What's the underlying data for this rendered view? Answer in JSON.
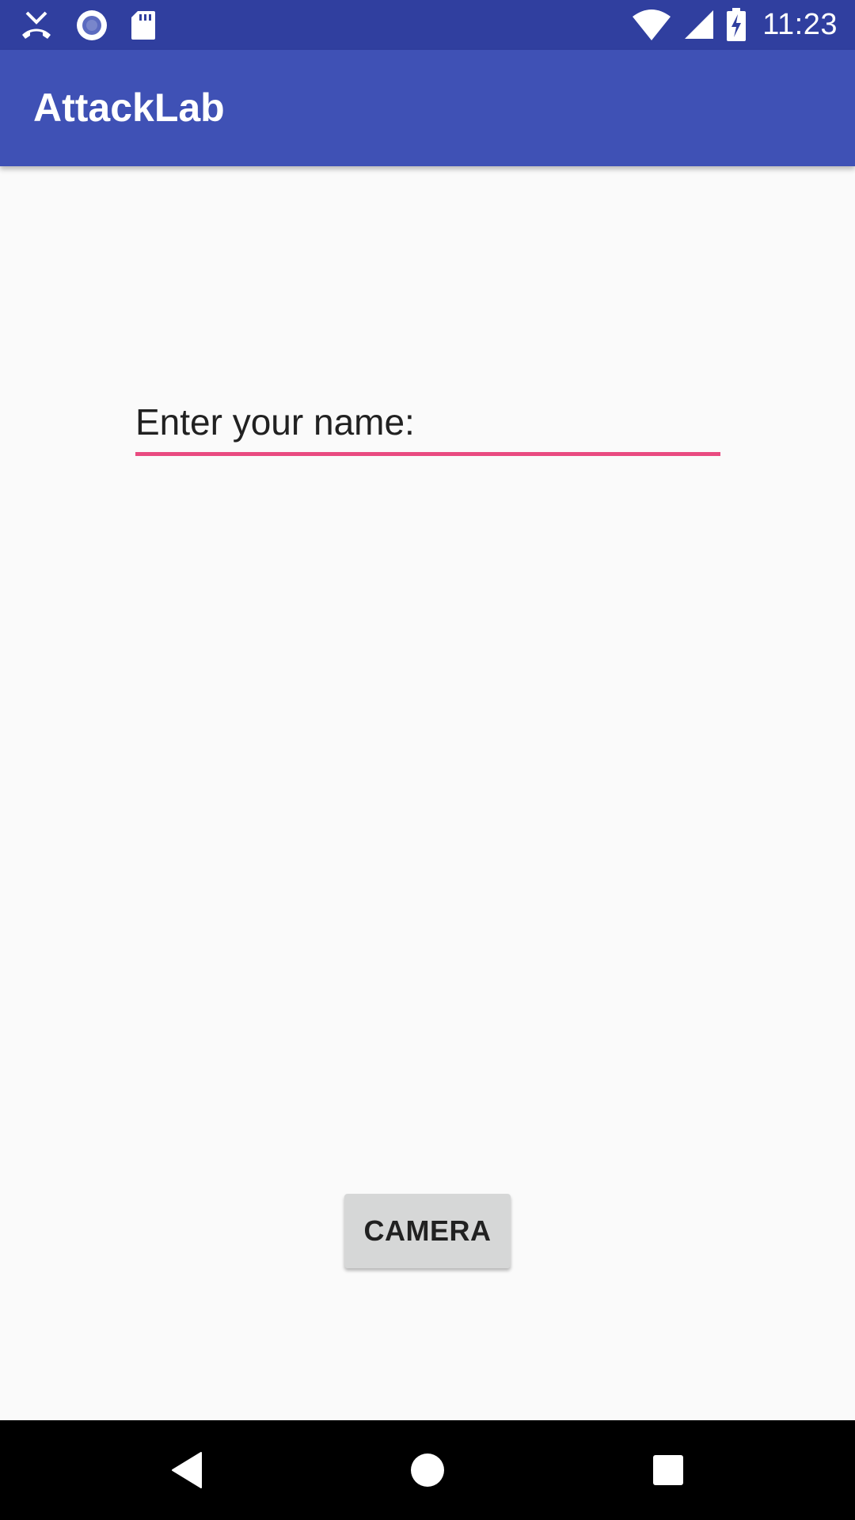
{
  "status_bar": {
    "time": "11:23",
    "left_icons": [
      "missed-call-icon",
      "sync-circle-icon",
      "sd-card-icon"
    ],
    "right_icons": [
      "wifi-icon",
      "cell-signal-icon",
      "battery-charging-icon"
    ]
  },
  "app_bar": {
    "title": "AttackLab",
    "color": "#3f51b5",
    "status_color": "#303f9f"
  },
  "form": {
    "name_label": "Enter your name:",
    "underline_color": "#e94b80"
  },
  "actions": {
    "camera_label": "CAMERA"
  },
  "nav_bar": {
    "buttons": [
      "back-icon",
      "home-icon",
      "recents-icon"
    ]
  }
}
